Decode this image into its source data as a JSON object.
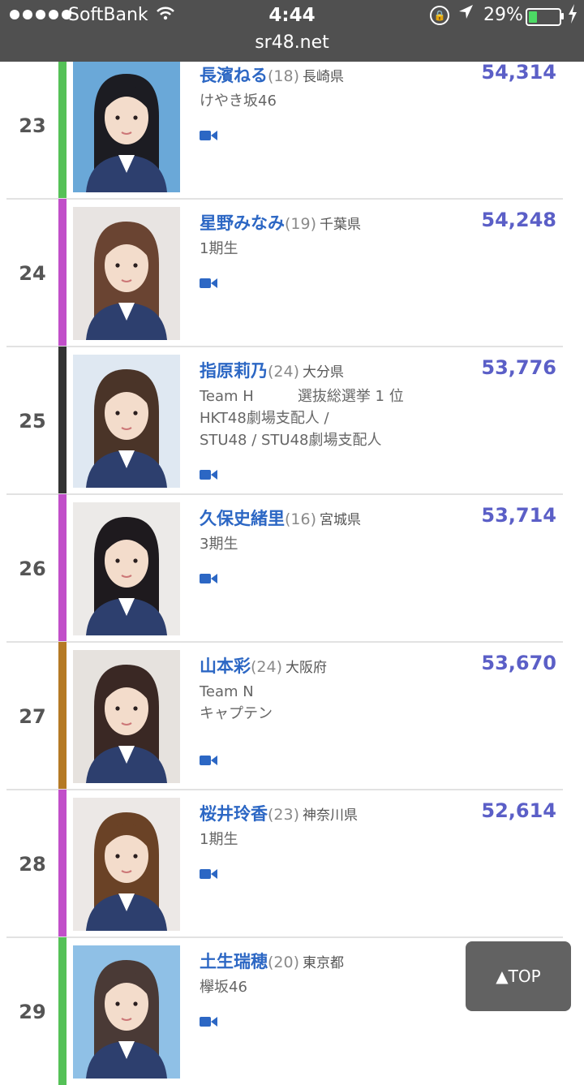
{
  "status_bar": {
    "carrier": "SoftBank",
    "time": "4:44",
    "battery_percent": "29%",
    "battery_level": 0.29
  },
  "browser": {
    "url": "sr48.net"
  },
  "rows": [
    {
      "rank": "23",
      "name": "長濱ねる",
      "age": "(18)",
      "prefecture": "長崎県",
      "info": "けやき坂46",
      "votes": "54,314",
      "bar_color": "#55c157"
    },
    {
      "rank": "24",
      "name": "星野みなみ",
      "age": "(19)",
      "prefecture": "千葉県",
      "info": "1期生",
      "votes": "54,248",
      "bar_color": "#c14fc9"
    },
    {
      "rank": "25",
      "name": "指原莉乃",
      "age": "(24)",
      "prefecture": "大分県",
      "info": "Team H　　　選抜総選挙 1 位\nHKT48劇場支配人 /\nSTU48 / STU48劇場支配人",
      "votes": "53,776",
      "bar_color": "#333333"
    },
    {
      "rank": "26",
      "name": "久保史緒里",
      "age": "(16)",
      "prefecture": "宮城県",
      "info": "3期生",
      "votes": "53,714",
      "bar_color": "#c14fc9"
    },
    {
      "rank": "27",
      "name": "山本彩",
      "age": "(24)",
      "prefecture": "大阪府",
      "info": "Team N\nキャプテン",
      "votes": "53,670",
      "bar_color": "#b57a25"
    },
    {
      "rank": "28",
      "name": "桜井玲香",
      "age": "(23)",
      "prefecture": "神奈川県",
      "info": "1期生",
      "votes": "52,614",
      "bar_color": "#c14fc9"
    },
    {
      "rank": "29",
      "name": "土生瑞穂",
      "age": "(20)",
      "prefecture": "東京都",
      "info": "欅坂46",
      "votes": "",
      "bar_color": "#55c157"
    }
  ],
  "top_button": {
    "label": "▲TOP"
  },
  "colors": {
    "name_link": "#2c67c4",
    "votes": "#5b5fc7",
    "video_icon": "#2c67c4"
  }
}
